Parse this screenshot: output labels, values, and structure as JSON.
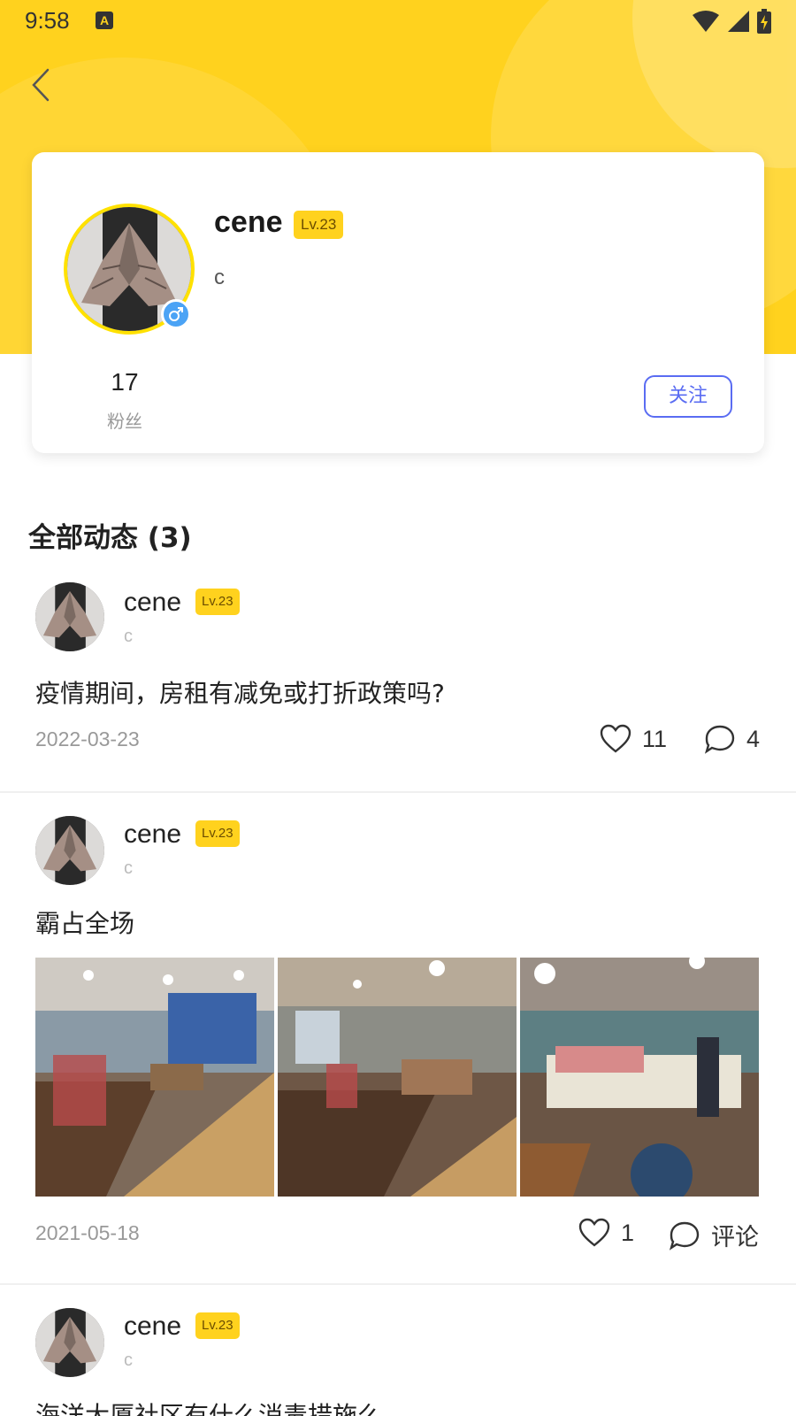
{
  "status_bar": {
    "time": "9:58",
    "notif_glyph": "A"
  },
  "header": {
    "back_icon": "chevron-left-icon"
  },
  "profile": {
    "name": "cene",
    "level": "Lv.23",
    "signature": "c",
    "gender_icon": "male-icon",
    "fans_count": "17",
    "fans_label": "粉丝",
    "follow_label": "关注"
  },
  "section": {
    "title": "全部动态 (3)"
  },
  "posts": [
    {
      "name": "cene",
      "level": "Lv.23",
      "signature": "c",
      "text": "疫情期间，房租有减免或打折政策吗?",
      "date": "2022-03-23",
      "likes": "11",
      "comments": "4"
    },
    {
      "name": "cene",
      "level": "Lv.23",
      "signature": "c",
      "text": "霸占全场",
      "date": "2021-05-18",
      "likes": "1",
      "comments": "评论",
      "photos": [
        "lounge-photo-1",
        "lounge-photo-2",
        "lounge-photo-3"
      ]
    },
    {
      "name": "cene",
      "level": "Lv.23",
      "signature": "c",
      "text": "海洋大厦社区有什么消毒措施么"
    }
  ],
  "colors": {
    "accent": "#FFD21E",
    "follow": "#5A6CF2",
    "gender": "#4BA3F5"
  }
}
